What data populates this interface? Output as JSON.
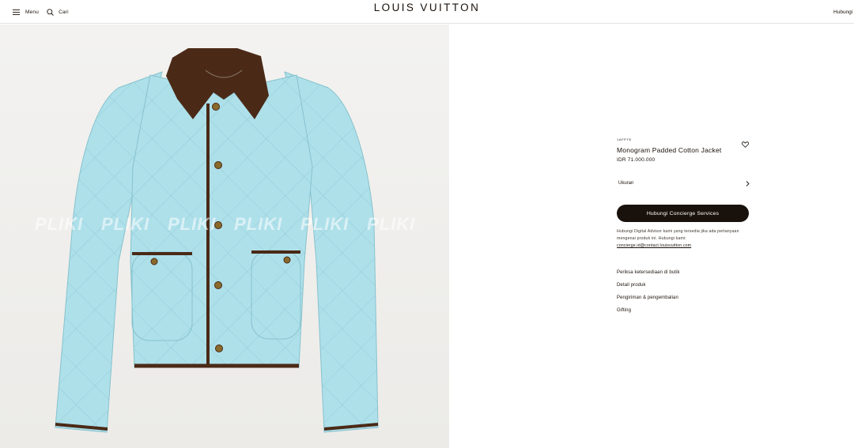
{
  "header": {
    "menu_label": "Menu",
    "search_label": "Cari",
    "logo": "LOUIS VUITTON",
    "contact_label": "Hubungi Ka"
  },
  "image": {
    "alt": "Monogram Padded Cotton Jacket",
    "watermark": "PLIKI",
    "jacket_color": "#aee0ea",
    "trim_color": "#4a2a17"
  },
  "product": {
    "sku": "1AFPTE",
    "title": "Monogram Padded Cotton Jacket",
    "price": "IDR 71.000.000",
    "size_label": "Ukuran",
    "cta_label": "Hubungi Concierge Services",
    "advisor_text": "Hubungi Digital Advisor kami yang tersedia jika ada pertanyaan mengenai produk ini. Hubungi kami:",
    "advisor_email": "concierge.id@contact.louisvuitton.com",
    "links": [
      "Periksa ketersediaan di butik",
      "Detail produk",
      "Pengiriman & pengembalian",
      "Gifting"
    ]
  },
  "colors": {
    "text": "#19110b",
    "cta_bg": "#19110b",
    "cta_text": "#ffffff"
  }
}
